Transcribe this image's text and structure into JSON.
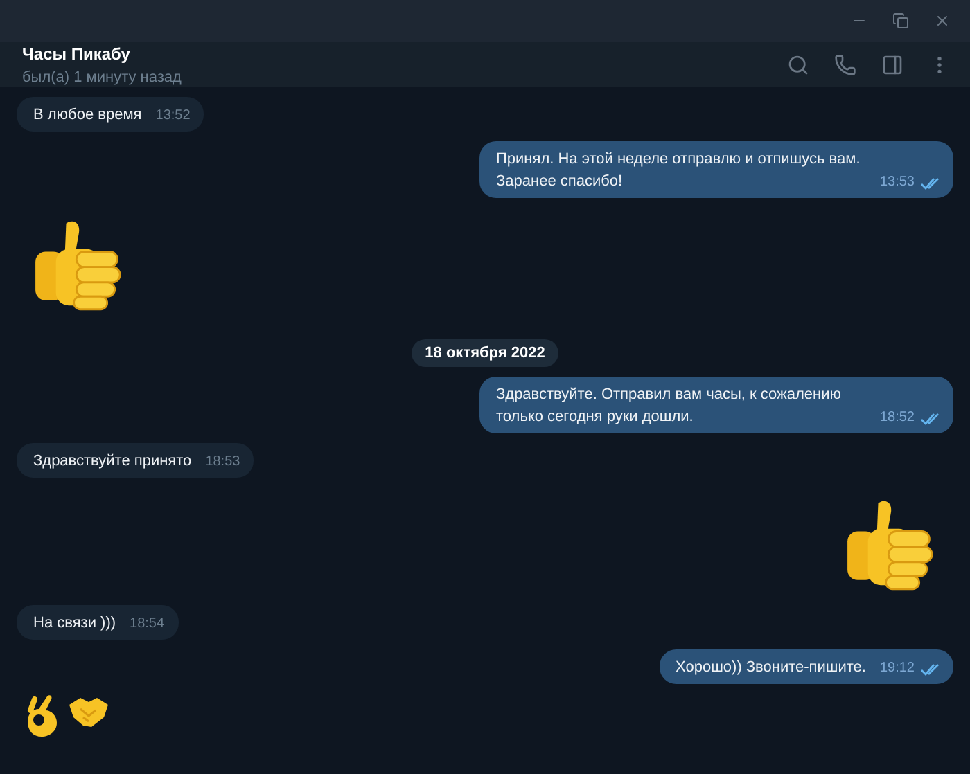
{
  "header": {
    "title": "Часы Пикабу",
    "status": "был(а) 1 минуту назад"
  },
  "messages": [
    {
      "kind": "text",
      "outgoing": false,
      "text": "В любое время",
      "time": "13:52"
    },
    {
      "kind": "text",
      "outgoing": true,
      "text": "Принял. На этой неделе отправлю и отпишусь вам. Заранее спасибо!",
      "time": "13:53",
      "read": true
    },
    {
      "kind": "sticker",
      "outgoing": false
    },
    {
      "kind": "date",
      "text": "18 октября 2022"
    },
    {
      "kind": "text",
      "outgoing": true,
      "text": "Здравствуйте. Отправил вам часы, к сожалению только сегодня руки дошли.",
      "time": "18:52",
      "read": true
    },
    {
      "kind": "text",
      "outgoing": false,
      "text": "Здравствуйте принято",
      "time": "18:53"
    },
    {
      "kind": "sticker",
      "outgoing": true
    },
    {
      "kind": "text",
      "outgoing": false,
      "text": "На связи )))",
      "time": "18:54"
    },
    {
      "kind": "text",
      "outgoing": true,
      "text": "Хорошо)) Звоните-пишите.",
      "time": "19:12",
      "read": true
    },
    {
      "kind": "emoji_pair",
      "outgoing": false
    }
  ]
}
